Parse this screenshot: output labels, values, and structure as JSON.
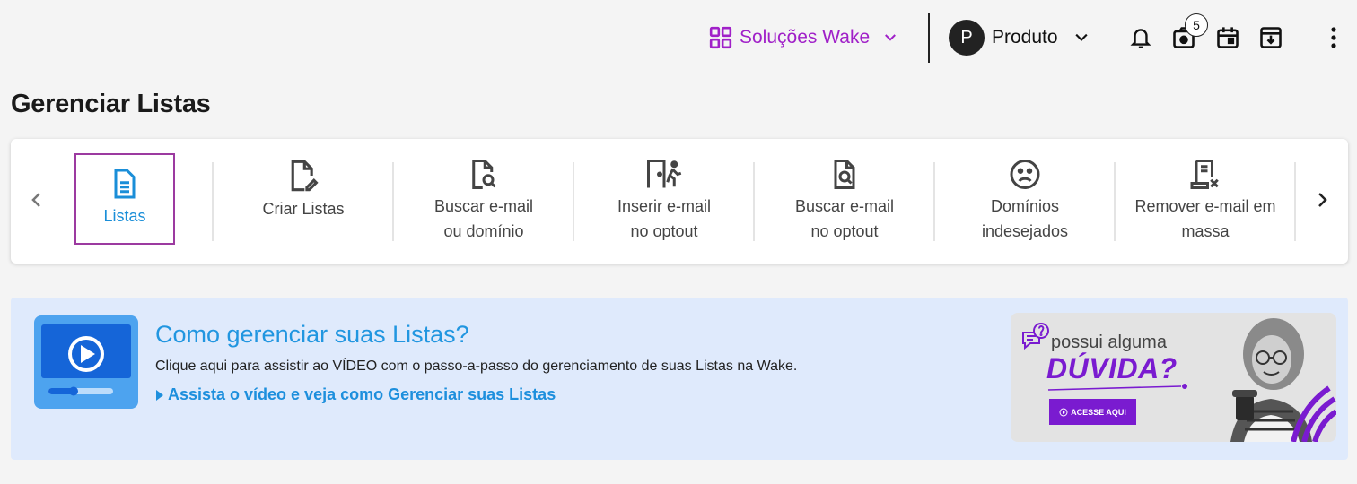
{
  "header": {
    "solucoes_label": "Soluções Wake",
    "user_initial": "P",
    "user_name": "Produto",
    "badge_count": "5"
  },
  "page": {
    "title": "Gerenciar Listas"
  },
  "tabs": [
    {
      "line1": "Listas",
      "line2": "",
      "icon": "document-icon",
      "active": true
    },
    {
      "line1": "Criar Listas",
      "line2": "",
      "icon": "document-edit-icon"
    },
    {
      "line1": "Buscar e-mail",
      "line2": "ou domínio",
      "icon": "document-search-icon"
    },
    {
      "line1": "Inserir e-mail",
      "line2": "no optout",
      "icon": "exit-door-icon"
    },
    {
      "line1": "Buscar e-mail",
      "line2": "no optout",
      "icon": "document-magnify-icon"
    },
    {
      "line1": "Domínios",
      "line2": "indesejados",
      "icon": "sad-face-icon"
    },
    {
      "line1": "Remover e-mail em",
      "line2": "massa",
      "icon": "document-remove-icon"
    }
  ],
  "banner": {
    "title": "Como gerenciar suas Listas?",
    "description": "Clique aqui para assistir ao VÍDEO com o passo-a-passo do gerenciamento de suas Listas na Wake.",
    "link": "Assista o vídeo e veja como Gerenciar suas Listas"
  },
  "ad": {
    "line1": "possui alguma",
    "line2": "DÚVIDA?",
    "button": "ACESSE AQUI"
  },
  "colors": {
    "accent_purple": "#a020c8",
    "link_blue": "#1d8fdd",
    "active_border": "#9c3aa0"
  }
}
